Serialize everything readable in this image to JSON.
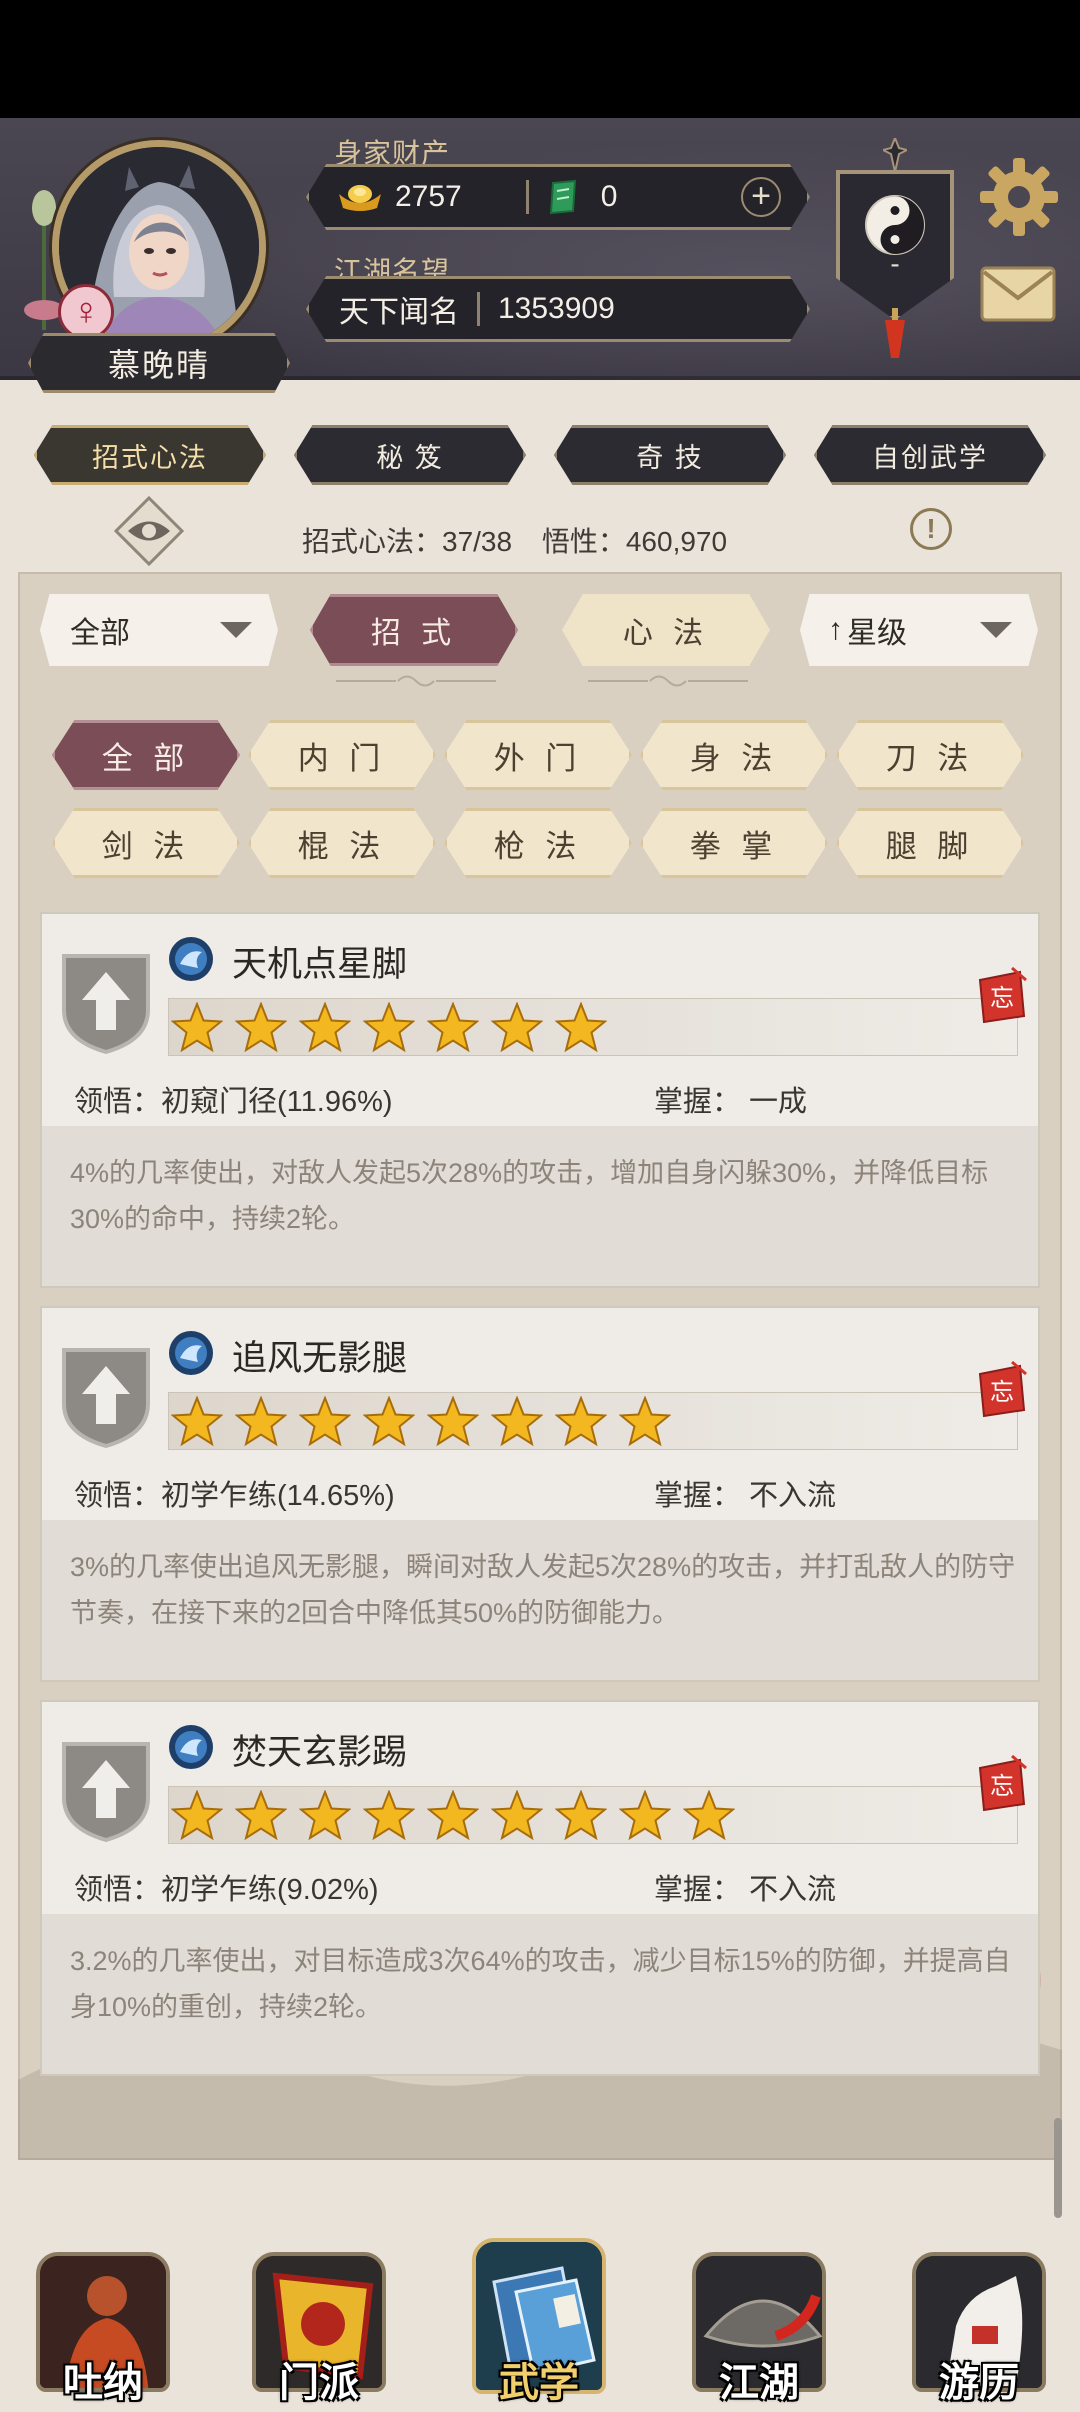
{
  "player": {
    "name": "慕晚晴",
    "gender_symbol": "♀"
  },
  "wealth": {
    "label": "身家财产",
    "gold": "2757",
    "jade": "0",
    "plus": "+"
  },
  "reputation": {
    "label": "江湖名望",
    "title": "天下闻名",
    "value": "1353909"
  },
  "sect_badge": {
    "value": "-"
  },
  "main_tabs": [
    {
      "label": "招式心法",
      "active": true
    },
    {
      "label": "秘 笈",
      "active": false
    },
    {
      "label": "奇 技",
      "active": false
    },
    {
      "label": "自创武学",
      "active": false
    }
  ],
  "stats": {
    "skills": "招式心法：37/38",
    "insight": "悟性：460,970",
    "info": "!"
  },
  "filters": {
    "type_dropdown": "全部",
    "seg_moves": "招 式",
    "seg_mind": "心 法",
    "sort_dropdown": "星级",
    "sort_arrow": "↑"
  },
  "categories": [
    {
      "label": "全 部",
      "active": true
    },
    {
      "label": "内 门",
      "active": false
    },
    {
      "label": "外 门",
      "active": false
    },
    {
      "label": "身 法",
      "active": false
    },
    {
      "label": "刀 法",
      "active": false
    },
    {
      "label": "剑 法",
      "active": false
    },
    {
      "label": "棍 法",
      "active": false
    },
    {
      "label": "枪 法",
      "active": false
    },
    {
      "label": "拳 掌",
      "active": false
    },
    {
      "label": "腿 脚",
      "active": false
    }
  ],
  "skills": [
    {
      "name": "天机点星脚",
      "stars": 7,
      "comprehension": "领悟：初窥门径(11.96%)",
      "mastery": "掌握：  一成",
      "forget_label": "忘",
      "description": "4%的几率使出，对敌人发起5次28%的攻击，增加自身闪躲30%，并降低目标30%的命中，持续2轮。"
    },
    {
      "name": "追风无影腿",
      "stars": 8,
      "comprehension": "领悟：初学乍练(14.65%)",
      "mastery": "掌握：  不入流",
      "forget_label": "忘",
      "description": "3%的几率使出追风无影腿，瞬间对敌人发起5次28%的攻击，并打乱敌人的防守节奏，在接下来的2回合中降低其50%的防御能力。"
    },
    {
      "name": "焚天玄影踢",
      "stars": 9,
      "comprehension": "领悟：初学乍练(9.02%)",
      "mastery": "掌握：  不入流",
      "forget_label": "忘",
      "description": "3.2%的几率使出，对目标造成3次64%的攻击，减少目标15%的防御，并提高自身10%的重创，持续2轮。"
    }
  ],
  "bottom_nav": [
    {
      "label": "吐纳",
      "active": false
    },
    {
      "label": "门派",
      "active": false
    },
    {
      "label": "武学",
      "active": true
    },
    {
      "label": "江湖",
      "active": false
    },
    {
      "label": "游历",
      "active": false
    }
  ],
  "colors": {
    "header_bg": "#4a4652",
    "active_maroon": "#7b4d57",
    "gold_accent": "#c9ad72",
    "star_gold": "#f3b81f"
  }
}
